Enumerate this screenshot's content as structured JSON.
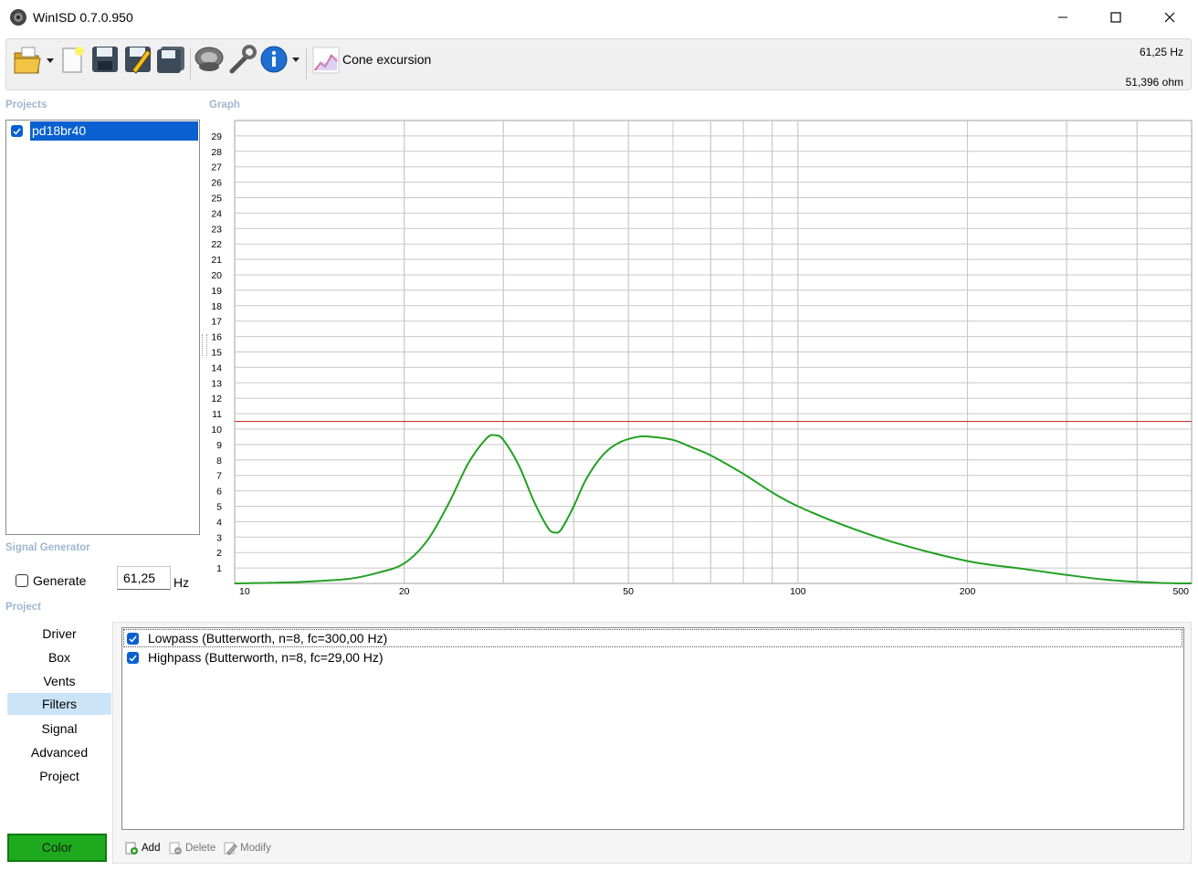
{
  "window": {
    "title": "WinISD 0.7.0.950",
    "controls": [
      "minimize",
      "maximize",
      "close"
    ]
  },
  "toolbar": {
    "buttons": [
      "open-folder-icon",
      "new-project-icon",
      "save-icon",
      "save-as-icon",
      "save-all-icon",
      "driver-icon",
      "tools-icon",
      "info-icon"
    ],
    "graph_selector_label": "Cone excursion",
    "cursor_frequency": "61,25 Hz",
    "cursor_impedance": "51,396 ohm"
  },
  "projects": {
    "title": "Projects",
    "items": [
      {
        "label": "pd18br40",
        "checked": true,
        "selected": true
      }
    ]
  },
  "graph": {
    "title": "Graph"
  },
  "signal_generator": {
    "title": "Signal Generator",
    "generate_label": "Generate",
    "generate_checked": false,
    "frequency_value": "61,25",
    "unit": "Hz"
  },
  "project_section": {
    "title": "Project",
    "tabs": [
      "Driver",
      "Box",
      "Vents",
      "Filters",
      "Signal",
      "Advanced",
      "Project"
    ],
    "active_tab": "Filters",
    "color_button": "Color",
    "color_value": "#1eaa1e"
  },
  "filters": {
    "items": [
      {
        "label": "Lowpass (Butterworth, n=8, fc=300,00 Hz)",
        "checked": true
      },
      {
        "label": "Highpass (Butterworth, n=8, fc=29,00 Hz)",
        "checked": true
      }
    ],
    "actions": {
      "add": "Add",
      "delete": "Delete",
      "modify": "Modify"
    }
  },
  "chart_data": {
    "type": "line",
    "x_scale": "log",
    "xlim": [
      10,
      500
    ],
    "ylim": [
      0,
      30
    ],
    "x_tick_labels": [
      "10",
      "20",
      "50",
      "100",
      "200",
      "500"
    ],
    "y_tick_labels": [
      "1",
      "2",
      "3",
      "4",
      "5",
      "6",
      "7",
      "8",
      "9",
      "10",
      "11",
      "12",
      "13",
      "14",
      "15",
      "16",
      "17",
      "18",
      "19",
      "20",
      "21",
      "22",
      "23",
      "24",
      "25",
      "26",
      "27",
      "28",
      "29"
    ],
    "grid": true,
    "limit_line": {
      "y": 10.5,
      "color": "#cc3333"
    },
    "series": [
      {
        "color": "#22a022",
        "x": [
          10,
          12,
          14,
          16,
          18,
          20,
          22,
          24,
          26,
          28,
          29,
          30,
          32,
          34,
          36,
          37,
          38,
          40,
          42,
          45,
          48,
          52,
          55,
          60,
          65,
          70,
          80,
          90,
          100,
          120,
          150,
          200,
          250,
          300,
          350,
          400,
          450,
          500
        ],
        "y": [
          0.0,
          0.05,
          0.15,
          0.3,
          0.7,
          1.3,
          2.8,
          5.2,
          7.8,
          9.4,
          9.6,
          9.3,
          7.6,
          5.3,
          3.6,
          3.3,
          3.5,
          5.0,
          6.7,
          8.3,
          9.1,
          9.5,
          9.5,
          9.3,
          8.8,
          8.3,
          7.1,
          5.9,
          5.0,
          3.8,
          2.6,
          1.45,
          0.95,
          0.55,
          0.25,
          0.1,
          0.02,
          0.0
        ]
      }
    ]
  }
}
